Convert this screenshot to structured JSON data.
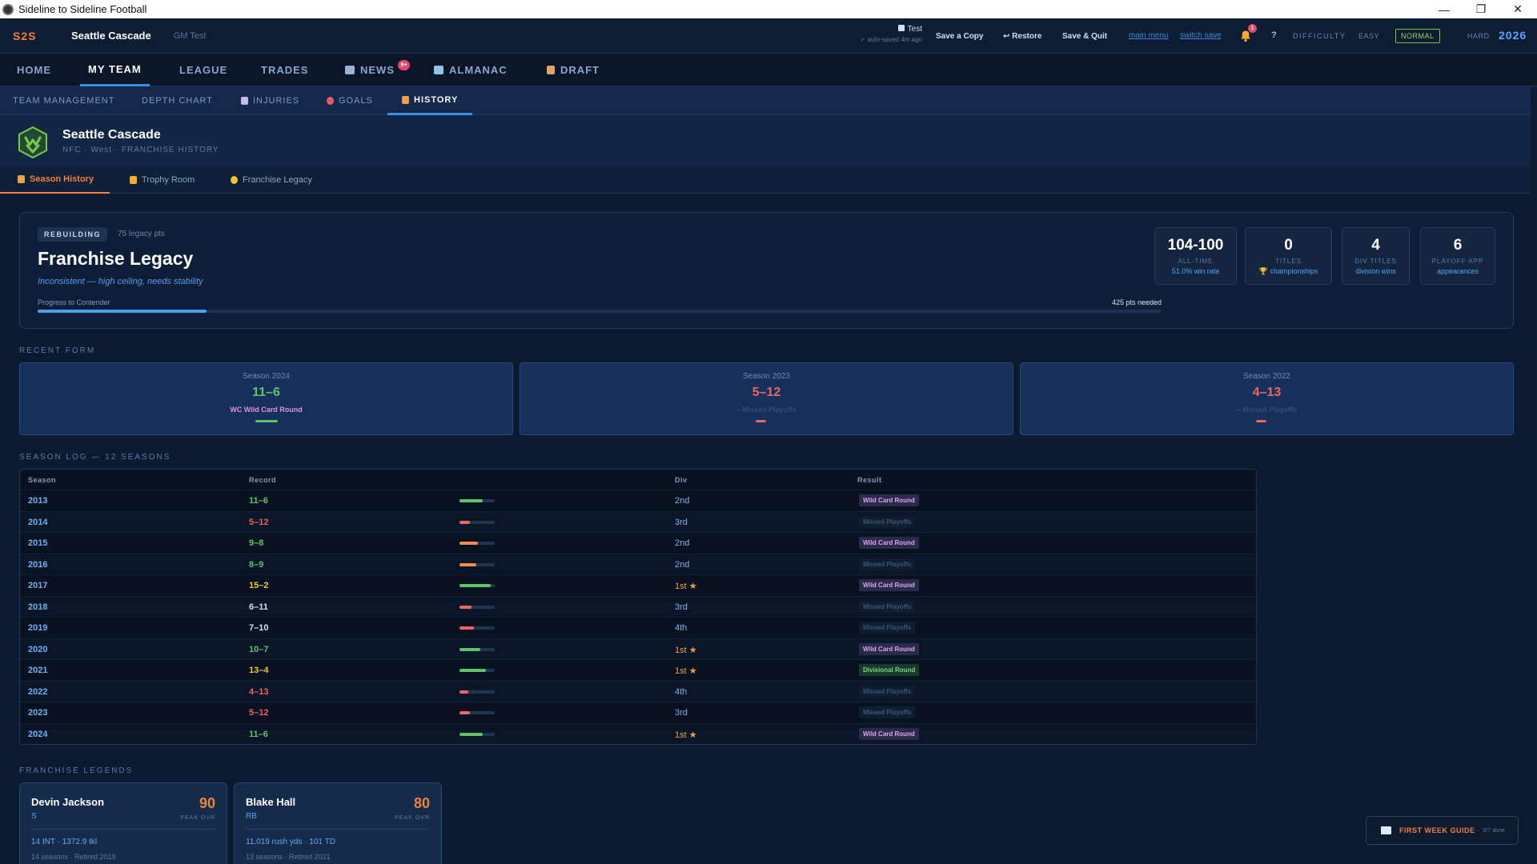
{
  "window": {
    "title": "Sideline to Sideline Football",
    "minimize": "—",
    "maximize": "❐",
    "close": "✕"
  },
  "topbar": {
    "brand": "S2S",
    "team": "Seattle Cascade",
    "gm": "GM Test",
    "save_name": "Test",
    "autosave": "✓ auto-saved 4m ago",
    "save_copy": "Save a Copy",
    "restore": "↩ Restore",
    "save_quit": "Save & Quit",
    "main_menu": "main menu",
    "switch_save": "switch save",
    "notifications": "1",
    "help": "?",
    "difficulty_label": "DIFFICULTY",
    "difficulty_options": [
      "EASY",
      "NORMAL",
      "HARD"
    ],
    "difficulty_selected": "NORMAL",
    "year": "2026"
  },
  "nav": {
    "items": [
      "HOME",
      "MY TEAM",
      "LEAGUE",
      "TRADES",
      "NEWS",
      "ALMANAC",
      "DRAFT"
    ],
    "active": "MY TEAM",
    "news_badge": "9+"
  },
  "subnav": {
    "items": [
      "TEAM MANAGEMENT",
      "DEPTH CHART",
      "INJURIES",
      "GOALS",
      "HISTORY"
    ],
    "active": "HISTORY"
  },
  "team_header": {
    "name": "Seattle Cascade",
    "subtitle": "NFC · West · FRANCHISE HISTORY"
  },
  "history_tabs": {
    "items": [
      "Season History",
      "Trophy Room",
      "Franchise Legacy"
    ],
    "active": "Season History"
  },
  "legacy": {
    "tag": "REBUILDING",
    "points": "75 legacy pts",
    "title": "Franchise Legacy",
    "description": "Inconsistent — high ceiling, needs stability",
    "progress_label": "Progress to Contender",
    "progress_needed": "425 pts needed",
    "progress_value": 0.15,
    "stats": [
      {
        "value": "104-100",
        "label": "ALL-TIME",
        "detail": "51.0% win rate"
      },
      {
        "value": "0",
        "label": "TITLES",
        "detail": "🏆 championships"
      },
      {
        "value": "4",
        "label": "DIV TITLES",
        "detail": "division wins"
      },
      {
        "value": "6",
        "label": "PLAYOFF APP",
        "detail": "appearances"
      }
    ]
  },
  "recent_form": {
    "label": "RECENT FORM",
    "cards": [
      {
        "season": "Season 2024",
        "record": "11–6",
        "outcome": "WC Wild Card Round",
        "color": "#5fc26b",
        "outcome_color": "#e38ee6"
      },
      {
        "season": "Season 2023",
        "record": "5–12",
        "outcome": "– Missed Playoffs",
        "color": "#ef6464",
        "outcome_color": "#2f4e78"
      },
      {
        "season": "Season 2022",
        "record": "4–13",
        "outcome": "– Missed Playoffs",
        "color": "#ef6464",
        "outcome_color": "#2f4e78"
      }
    ]
  },
  "season_log": {
    "label": "SEASON LOG — 12 SEASONS",
    "columns": [
      "Season",
      "Record",
      "Div",
      "Result"
    ],
    "rows": [
      {
        "season": "2013",
        "record": "11–6",
        "win_pct": 0.65,
        "div": "2nd",
        "result": "Wild Card Round",
        "tone": "good"
      },
      {
        "season": "2014",
        "record": "5–12",
        "win_pct": 0.29,
        "div": "3rd",
        "result": "Missed Playoffs",
        "tone": "bad"
      },
      {
        "season": "2015",
        "record": "9–8",
        "win_pct": 0.53,
        "div": "2nd",
        "result": "Wild Card Round",
        "tone": "mid"
      },
      {
        "season": "2016",
        "record": "8–9",
        "win_pct": 0.47,
        "div": "2nd",
        "result": "Missed Playoffs",
        "tone": "mid"
      },
      {
        "season": "2017",
        "record": "15–2",
        "win_pct": 0.88,
        "div": "1st ★",
        "result": "Wild Card Round",
        "tone": "great"
      },
      {
        "season": "2018",
        "record": "6–11",
        "win_pct": 0.35,
        "div": "3rd",
        "result": "Missed Playoffs",
        "tone": "neutral"
      },
      {
        "season": "2019",
        "record": "7–10",
        "win_pct": 0.41,
        "div": "4th",
        "result": "Missed Playoffs",
        "tone": "neutral"
      },
      {
        "season": "2020",
        "record": "10–7",
        "win_pct": 0.59,
        "div": "1st ★",
        "result": "Wild Card Round",
        "tone": "good"
      },
      {
        "season": "2021",
        "record": "13–4",
        "win_pct": 0.76,
        "div": "1st ★",
        "result": "Divisional Round",
        "tone": "great"
      },
      {
        "season": "2022",
        "record": "4–13",
        "win_pct": 0.24,
        "div": "4th",
        "result": "Missed Playoffs",
        "tone": "bad"
      },
      {
        "season": "2023",
        "record": "5–12",
        "win_pct": 0.29,
        "div": "3rd",
        "result": "Missed Playoffs",
        "tone": "bad"
      },
      {
        "season": "2024",
        "record": "11–6",
        "win_pct": 0.65,
        "div": "1st ★",
        "result": "Wild Card Round",
        "tone": "good"
      }
    ]
  },
  "legends": {
    "label": "FRANCHISE LEGENDS",
    "players": [
      {
        "name": "Devin Jackson",
        "pos": "S",
        "ovr": "90",
        "ovr_label": "PEAK OVR",
        "stats": "14 INT · 1372.9 tkl",
        "tenure": "14 seasons · Retired 2019"
      },
      {
        "name": "Blake Hall",
        "pos": "RB",
        "ovr": "80",
        "ovr_label": "PEAK OVR",
        "stats": "11,019 rush yds · 101 TD",
        "tenure": "13 seasons · Retired 2021"
      }
    ]
  },
  "guide": {
    "title": "FIRST WEEK GUIDE",
    "done": "0/7 done"
  },
  "colors": {
    "accent": "#f0803c",
    "blue": "#3a8ee6",
    "win": "#5fc26b",
    "loss": "#ef6464",
    "great": "#f3c53b"
  }
}
